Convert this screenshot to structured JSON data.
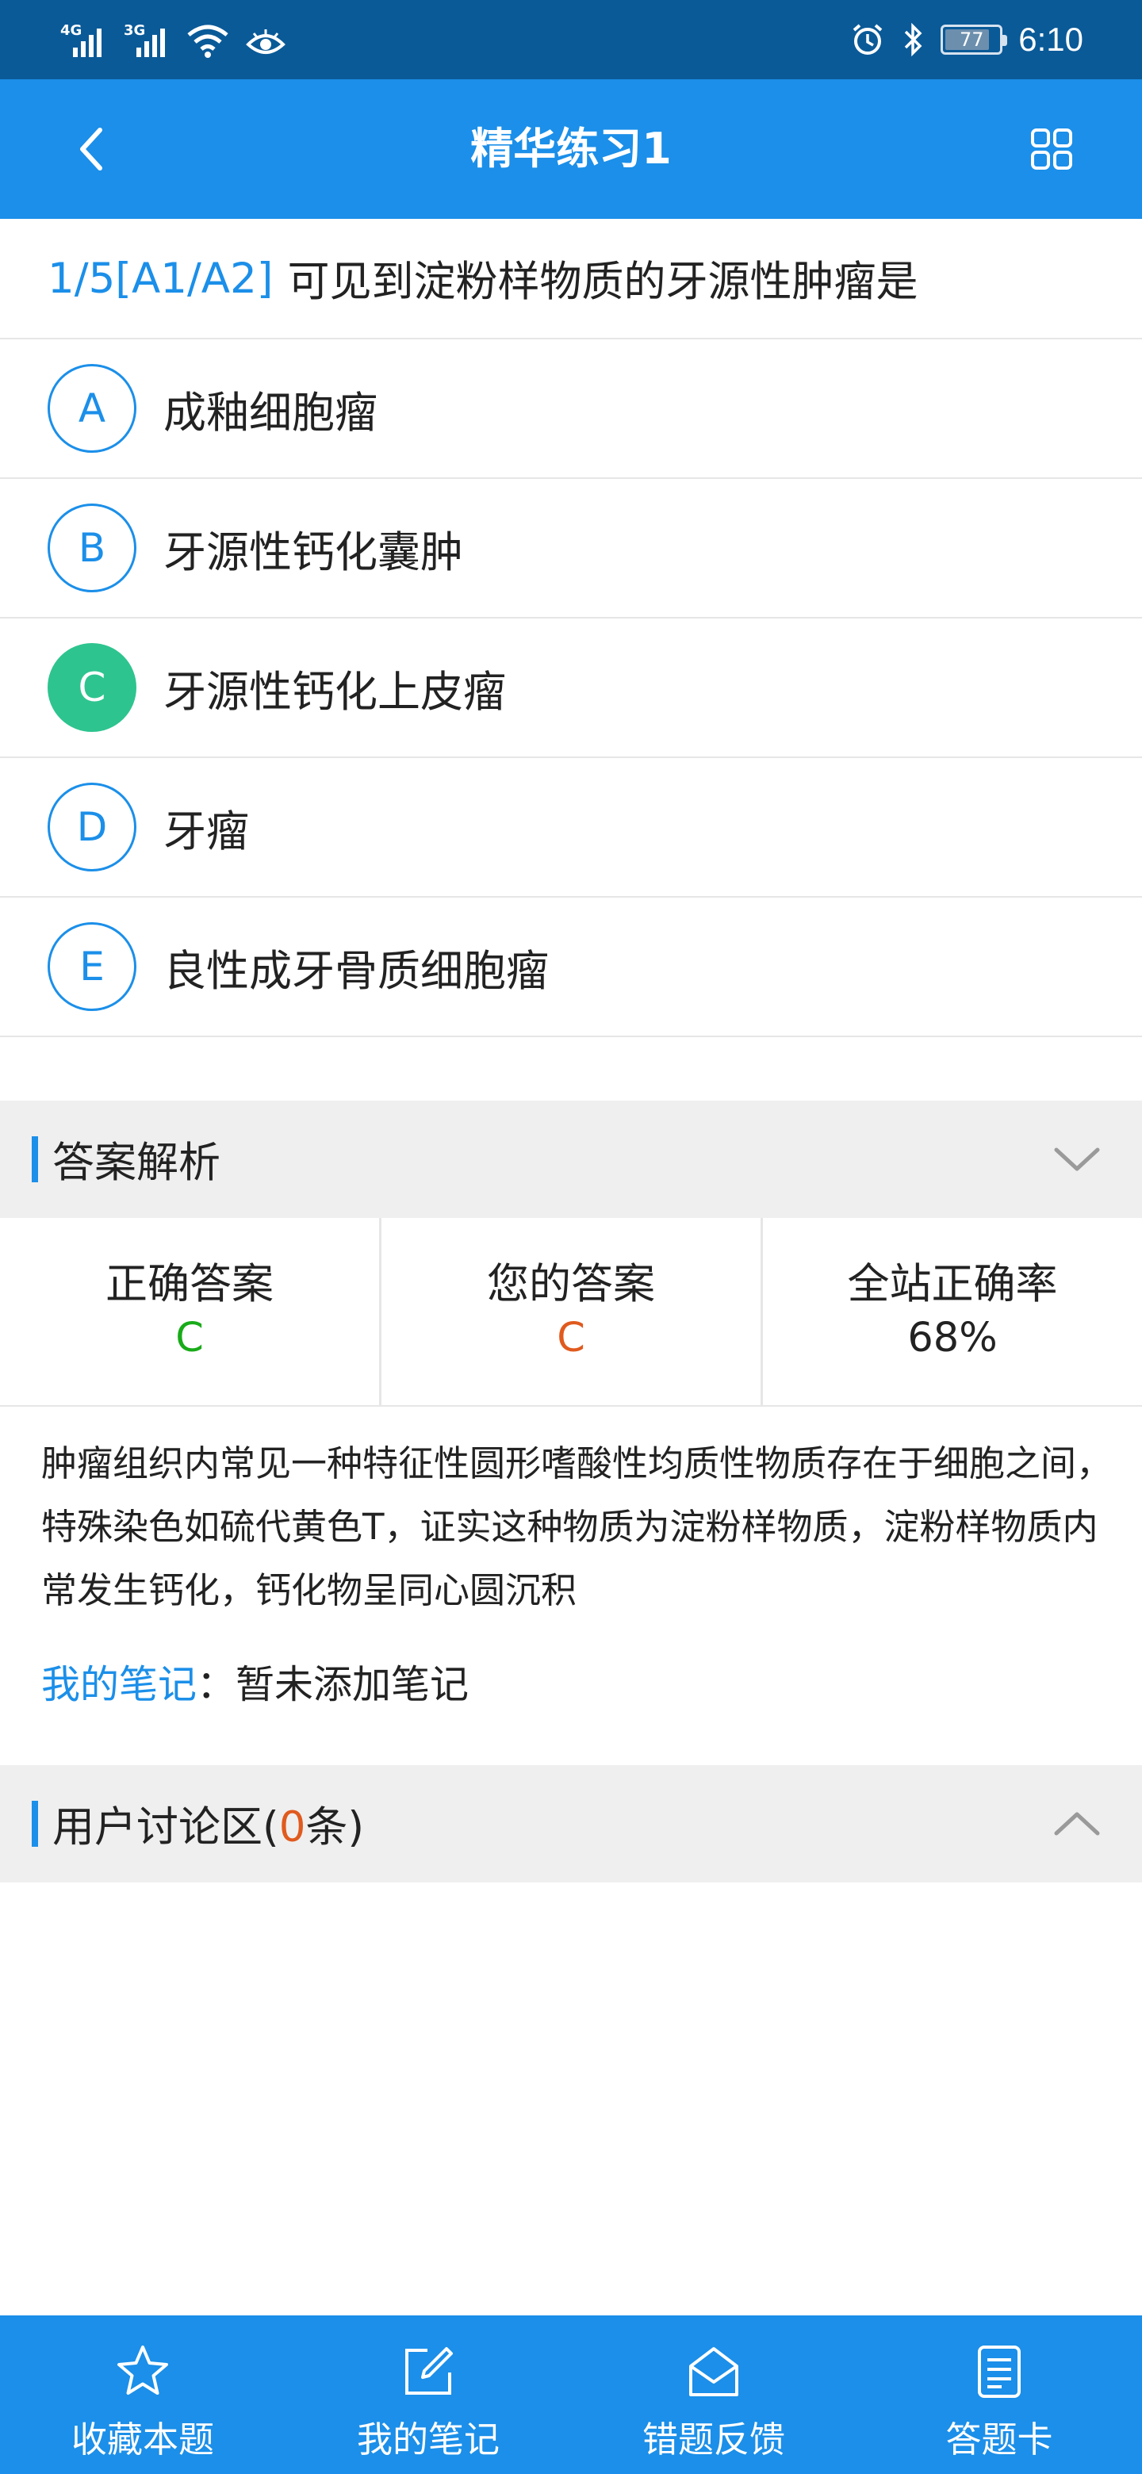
{
  "status_bar": {
    "network_1": "4G",
    "network_2": "3G",
    "battery": "77",
    "time": "6:10"
  },
  "header": {
    "title": "精华练习1"
  },
  "question": {
    "number": "1/5[A1/A2]",
    "text": "可见到淀粉样物质的牙源性肿瘤是"
  },
  "options": [
    {
      "letter": "A",
      "text": "成釉细胞瘤",
      "selected": false
    },
    {
      "letter": "B",
      "text": "牙源性钙化囊肿",
      "selected": false
    },
    {
      "letter": "C",
      "text": "牙源性钙化上皮瘤",
      "selected": true
    },
    {
      "letter": "D",
      "text": "牙瘤",
      "selected": false
    },
    {
      "letter": "E",
      "text": "良性成牙骨质细胞瘤",
      "selected": false
    }
  ],
  "analysis": {
    "title": "答案解析",
    "correct_label": "正确答案",
    "correct_value": "C",
    "your_label": "您的答案",
    "your_value": "C",
    "rate_label": "全站正确率",
    "rate_value": "68%",
    "explanation": "肿瘤组织内常见一种特征性圆形嗜酸性均质性物质存在于细胞之间，特殊染色如硫代黄色T，证实这种物质为淀粉样物质，淀粉样物质内常发生钙化，钙化物呈同心圆沉积",
    "notes_link": "我的笔记",
    "notes_text": "：暂未添加笔记"
  },
  "discussion": {
    "title_prefix": "用户讨论区(",
    "count": "0",
    "title_suffix": "条)"
  },
  "bottom_bar": {
    "favorite": "收藏本题",
    "notes": "我的笔记",
    "feedback": "错题反馈",
    "answer_card": "答题卡"
  },
  "colors": {
    "primary": "#1b8fe9",
    "status_bar": "#0a5a98",
    "correct_option": "#2ec48f",
    "correct_answer": "#19ab19",
    "your_answer": "#e05a1e"
  }
}
